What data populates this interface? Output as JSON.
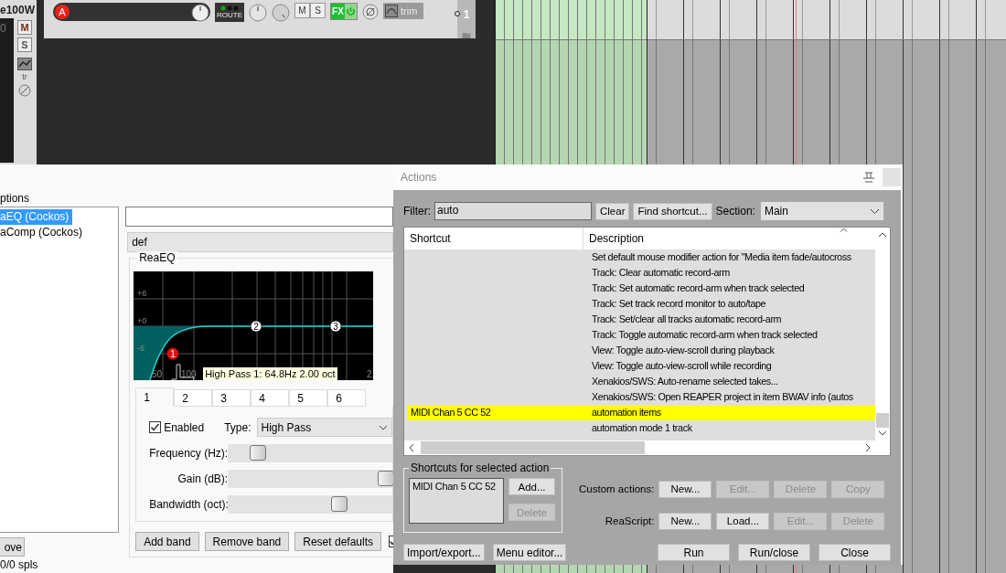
{
  "track_panel": {
    "name": "e100W",
    "meter_value": "0",
    "mute": "M",
    "solo": "S",
    "envelope_label": "tr"
  },
  "track_header": {
    "record_arm": "A",
    "route": "ROUTE",
    "mute": "M",
    "solo": "S",
    "fx": "FX",
    "fx_enabled": true,
    "trim": "trim",
    "number": "1"
  },
  "fx_window": {
    "options_label": "ptions",
    "fx_list": [
      {
        "name": "aEQ (Cockos)",
        "selected": true
      },
      {
        "name": "aComp (Cockos)",
        "selected": false
      }
    ],
    "preset": "def",
    "group_label": "ReaEQ",
    "graph": {
      "y_labels": [
        "+6",
        "+0",
        "-6"
      ],
      "x_labels": [
        "50",
        "100",
        "2."
      ],
      "nodes": [
        {
          "label": "1",
          "selected": true
        },
        {
          "label": "2",
          "selected": false
        },
        {
          "label": "3",
          "selected": false
        }
      ],
      "tooltip": "High Pass 1: 64.8Hz 2.00 oct"
    },
    "band_tabs": [
      {
        "label": "1",
        "selected": true
      },
      {
        "label": "2",
        "selected": false
      },
      {
        "label": "3",
        "selected": false
      },
      {
        "label": "4",
        "selected": false
      },
      {
        "label": "5",
        "selected": false
      },
      {
        "label": "6",
        "selected": false
      }
    ],
    "enabled": {
      "label": "Enabled",
      "checked": true
    },
    "type_label": "Type:",
    "type_value": "High Pass",
    "sliders": [
      {
        "label": "Frequency (Hz):",
        "level": 0.18
      },
      {
        "label": "Gain (dB):",
        "level": 0.96
      },
      {
        "label": "Bandwidth (oct):",
        "level": 0.68
      }
    ],
    "buttons": [
      "Add band",
      "Remove band",
      "Reset defaults"
    ],
    "side_checkbox": {
      "checked": true
    },
    "remove_button": "ove",
    "status": "0/0 spls"
  },
  "actions": {
    "title": "Actions",
    "filter_label": "Filter:",
    "filter_value": "auto",
    "clear": "Clear",
    "find": "Find shortcut...",
    "section_label": "Section:",
    "section_value": "Main",
    "columns": [
      "Shortcut",
      "Description"
    ],
    "rows": [
      {
        "description": "Set default mouse modifier action for \"Media item fade/autocross",
        "selected": false
      },
      {
        "description": "Track: Clear automatic record-arm",
        "selected": false
      },
      {
        "description": "Track: Set automatic record-arm when track selected",
        "selected": false
      },
      {
        "description": "Track: Set track record monitor to auto/tape",
        "selected": false
      },
      {
        "description": "Track: Set/clear all tracks automatic record-arm",
        "selected": false
      },
      {
        "description": "Track: Toggle automatic record-arm when track selected",
        "selected": false
      },
      {
        "description": "View: Toggle auto-view-scroll during playback",
        "selected": false
      },
      {
        "description": "View: Toggle auto-view-scroll while recording",
        "selected": false
      },
      {
        "description": "Xenakios/SWS: Auto-rename selected takes...",
        "selected": false
      },
      {
        "description": "Xenakios/SWS: Open REAPER project in item BWAV info (autos",
        "selected": false
      },
      {
        "shortcut": "MIDI Chan 5 CC 52",
        "description": "automation items",
        "selected": true
      },
      {
        "description": "automation mode 1 track",
        "selected": false
      }
    ],
    "shortcuts_group": {
      "label": "Shortcuts for selected action",
      "items": [
        "MIDI Chan 5 CC 52"
      ],
      "buttons": [
        {
          "label": "Add...",
          "disabled": false
        },
        {
          "label": "Delete",
          "disabled": true
        }
      ]
    },
    "custom_actions": {
      "label": "Custom actions:",
      "buttons": [
        {
          "label": "New...",
          "disabled": false
        },
        {
          "label": "Edit...",
          "disabled": true
        },
        {
          "label": "Delete",
          "disabled": true
        },
        {
          "label": "Copy",
          "disabled": true
        }
      ]
    },
    "reascript": {
      "label": "ReaScript:",
      "buttons": [
        {
          "label": "New...",
          "disabled": false
        },
        {
          "label": "Load...",
          "disabled": false
        },
        {
          "label": "Edit...",
          "disabled": true
        },
        {
          "label": "Delete",
          "disabled": true
        }
      ]
    },
    "bottom_left": [
      "Import/export...",
      "Menu editor..."
    ],
    "bottom_right": [
      "Run",
      "Run/close",
      "Close"
    ]
  }
}
